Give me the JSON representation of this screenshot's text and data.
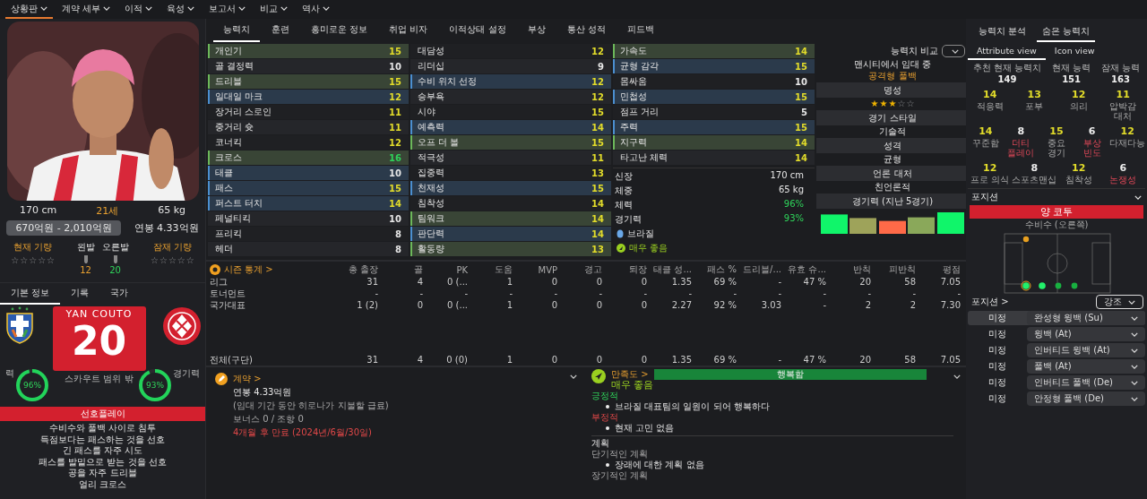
{
  "nav": [
    {
      "label": "상황판",
      "selected": true
    },
    {
      "label": "계약 세부",
      "selected": false
    },
    {
      "label": "이적",
      "selected": false
    },
    {
      "label": "육성",
      "selected": false
    },
    {
      "label": "보고서",
      "selected": false
    },
    {
      "label": "비교",
      "selected": false
    },
    {
      "label": "역사",
      "selected": false
    }
  ],
  "player": {
    "height": "170 cm",
    "age": "21세",
    "weight": "65 kg",
    "value_range": "670억원 - 2,010억원",
    "wage": "연봉 4.33억원",
    "current_ability": {
      "label": "현재 기량",
      "stars": 0
    },
    "potential_ability": {
      "label": "잠재 기량",
      "stars": 0
    },
    "feet": [
      {
        "label": "왼발",
        "value": "12",
        "color": "#e8a030"
      },
      {
        "label": "오른발",
        "value": "20",
        "color": "#2fd35a"
      }
    ]
  },
  "info_tabs": [
    {
      "label": "기본 정보",
      "selected": true
    },
    {
      "label": "기록",
      "selected": false
    },
    {
      "label": "국가",
      "selected": false
    }
  ],
  "shirt": {
    "name": "YAN COUTO",
    "number": "20",
    "note": "스카우트 범위 밖"
  },
  "rings": [
    {
      "label": "력",
      "value": "96%",
      "level": 0.96
    },
    {
      "label": "경기력",
      "value": "93%",
      "level": 0.93
    }
  ],
  "preferred_play": {
    "title": "선호플레이",
    "items": [
      "수비수와 풀백 사이로 침투",
      "득점보다는 패스하는 것을 선호",
      "긴 패스를 자주 시도",
      "패스를 발밑으로 받는 것을 선호",
      "공을 자주 드리블",
      "얼리 크로스"
    ]
  },
  "tabs": [
    {
      "label": "능력치",
      "selected": true
    },
    {
      "label": "훈련",
      "selected": false
    },
    {
      "label": "흥미로운 정보",
      "selected": false
    },
    {
      "label": "취업 비자",
      "selected": false
    },
    {
      "label": "이적상태 설정",
      "selected": false
    },
    {
      "label": "부상",
      "selected": false
    },
    {
      "label": "통산 성적",
      "selected": false
    },
    {
      "label": "피드백",
      "selected": false
    }
  ],
  "attributes": [
    [
      {
        "label": "개인기",
        "value": "15",
        "kind": "strong",
        "color": "#e2dc2a"
      },
      {
        "label": "골 결정력",
        "value": "10",
        "kind": "plain",
        "color": "#e6e6e6"
      },
      {
        "label": "드리블",
        "value": "15",
        "kind": "strong",
        "color": "#e2dc2a"
      },
      {
        "label": "일대일 마크",
        "value": "12",
        "kind": "key",
        "color": "#e2dc2a"
      },
      {
        "label": "장거리 스로인",
        "value": "11",
        "kind": "plain",
        "color": "#e2dc2a"
      },
      {
        "label": "중거리 슛",
        "value": "11",
        "kind": "plain",
        "color": "#e2dc2a"
      },
      {
        "label": "코너킥",
        "value": "12",
        "kind": "plain",
        "color": "#e2dc2a"
      },
      {
        "label": "크로스",
        "value": "16",
        "kind": "strong",
        "color": "#2fd35a"
      },
      {
        "label": "태클",
        "value": "10",
        "kind": "key",
        "color": "#e6e6e6"
      },
      {
        "label": "패스",
        "value": "15",
        "kind": "key",
        "color": "#e2dc2a"
      },
      {
        "label": "퍼스트 터치",
        "value": "14",
        "kind": "key",
        "color": "#e2dc2a"
      },
      {
        "label": "페널티킥",
        "value": "10",
        "kind": "plain",
        "color": "#e6e6e6"
      },
      {
        "label": "프리킥",
        "value": "8",
        "kind": "plain",
        "color": "#e6e6e6"
      },
      {
        "label": "헤더",
        "value": "8",
        "kind": "plain",
        "color": "#e6e6e6"
      }
    ],
    [
      {
        "label": "대담성",
        "value": "12",
        "kind": "plain",
        "color": "#e2dc2a"
      },
      {
        "label": "리더십",
        "value": "9",
        "kind": "plain",
        "color": "#e6e6e6"
      },
      {
        "label": "수비 위치 선정",
        "value": "12",
        "kind": "key",
        "color": "#e2dc2a"
      },
      {
        "label": "승부욕",
        "value": "12",
        "kind": "plain",
        "color": "#e2dc2a"
      },
      {
        "label": "시야",
        "value": "15",
        "kind": "plain",
        "color": "#e2dc2a"
      },
      {
        "label": "예측력",
        "value": "14",
        "kind": "key",
        "color": "#e2dc2a"
      },
      {
        "label": "오프 더 볼",
        "value": "15",
        "kind": "strong",
        "color": "#e2dc2a"
      },
      {
        "label": "적극성",
        "value": "11",
        "kind": "plain",
        "color": "#e2dc2a"
      },
      {
        "label": "집중력",
        "value": "13",
        "kind": "plain",
        "color": "#e2dc2a"
      },
      {
        "label": "천재성",
        "value": "15",
        "kind": "key",
        "color": "#e2dc2a"
      },
      {
        "label": "침착성",
        "value": "14",
        "kind": "plain",
        "color": "#e2dc2a"
      },
      {
        "label": "팀워크",
        "value": "14",
        "kind": "strong",
        "color": "#e2dc2a"
      },
      {
        "label": "판단력",
        "value": "14",
        "kind": "key",
        "color": "#e2dc2a"
      },
      {
        "label": "활동량",
        "value": "13",
        "kind": "strong",
        "color": "#e2dc2a"
      }
    ],
    [
      {
        "label": "가속도",
        "value": "14",
        "kind": "strong",
        "color": "#e2dc2a"
      },
      {
        "label": "균형 감각",
        "value": "15",
        "kind": "key",
        "color": "#e2dc2a"
      },
      {
        "label": "몸싸움",
        "value": "10",
        "kind": "plain",
        "color": "#e6e6e6"
      },
      {
        "label": "민첩성",
        "value": "15",
        "kind": "key",
        "color": "#e2dc2a"
      },
      {
        "label": "점프 거리",
        "value": "5",
        "kind": "plain",
        "color": "#e6e6e6"
      },
      {
        "label": "주력",
        "value": "15",
        "kind": "key",
        "color": "#e2dc2a"
      },
      {
        "label": "지구력",
        "value": "14",
        "kind": "strong",
        "color": "#e2dc2a"
      },
      {
        "label": "타고난 체력",
        "value": "14",
        "kind": "plain",
        "color": "#e2dc2a"
      }
    ]
  ],
  "physical": [
    {
      "label": "신장",
      "value": "170 cm",
      "color": "#e6e6e6"
    },
    {
      "label": "체중",
      "value": "65 kg",
      "color": "#e6e6e6"
    },
    {
      "label": "체력",
      "value": "96%",
      "color": "#2fd35a"
    },
    {
      "label": "경기력",
      "value": "93%",
      "color": "#2fd35a"
    }
  ],
  "nationality": "브라질",
  "condition": "매우 좋음",
  "profile": {
    "compare_label": "능력치 비교",
    "status": "맨시티에서 임대 중",
    "role": "공격형 풀백",
    "sections": [
      {
        "title": "명성",
        "kind": "stars",
        "stars": 3
      },
      {
        "title": "경기 스타일",
        "kind": "text",
        "value": "기술적"
      },
      {
        "title": "성격",
        "kind": "text",
        "value": "균형"
      },
      {
        "title": "언론 대처",
        "kind": "text",
        "value": "친언론적"
      },
      {
        "title": "경기력 (지난 5경기)",
        "kind": "form"
      }
    ]
  },
  "season_stats": {
    "title": "시즌 통계 >",
    "columns": [
      "총 출장",
      "골",
      "PK",
      "도움",
      "MVP",
      "경고",
      "퇴장",
      "태클 성...",
      "패스 %",
      "드리블/...",
      "유효 슈...",
      "반칙",
      "피반칙",
      "평점"
    ],
    "rows": [
      {
        "label": "리그",
        "cells": [
          "31",
          "4",
          "0 (...",
          "1",
          "0",
          "0",
          "0",
          "1.35",
          "69 %",
          "-",
          "47 %",
          "20",
          "58",
          "7.05"
        ]
      },
      {
        "label": "토너먼트",
        "cells": [
          "-",
          "-",
          "-",
          "-",
          "-",
          "-",
          "-",
          "-",
          "-",
          "-",
          "-",
          "-",
          "-",
          "-"
        ]
      },
      {
        "label": "국가대표",
        "cells": [
          "1 (2)",
          "0",
          "0 (...",
          "1",
          "0",
          "0",
          "0",
          "2.27",
          "92 %",
          "3.03",
          "-",
          "2",
          "2",
          "7.30"
        ]
      }
    ],
    "total": {
      "label": "전체(구단)",
      "cells": [
        "31",
        "4",
        "0 (0)",
        "1",
        "0",
        "0",
        "0",
        "1.35",
        "69 %",
        "-",
        "47 %",
        "20",
        "58",
        "7.05"
      ]
    }
  },
  "contract": {
    "title": "계약 >",
    "wage": "연봉 4.33억원",
    "note": "(임대 기간 동안 히로나가 지불할 급료)",
    "bonus": "보너스 0 / 조항 0",
    "expiry": "4개월 후 만료 (2024년/6월/30일)"
  },
  "morale": {
    "title": "만족도 >",
    "bar": {
      "label": "행복함",
      "level": 1
    },
    "status": "매우 좋음",
    "positive": {
      "title": "긍정적",
      "items": [
        "브라질 대표팀의 일원이 되어 행복하다"
      ]
    },
    "negative": {
      "title": "부정적",
      "items": [
        "현재 고민 없음"
      ]
    },
    "plans": {
      "title": "계획",
      "short_title": "단기적인 계획",
      "short_items": [
        "장래에 대한 계획 없음"
      ],
      "long_title": "장기적인 계획"
    }
  },
  "right": {
    "tabs": [
      {
        "label": "능력치 분석",
        "selected": false
      },
      {
        "label": "숨은 능력치",
        "selected": true
      }
    ],
    "views": [
      {
        "label": "Attribute view",
        "selected": true
      },
      {
        "label": "Icon view",
        "selected": false
      }
    ],
    "abilities": [
      {
        "label": "추천 현재 능력치",
        "value": "149"
      },
      {
        "label": "현재 능력",
        "value": "151"
      },
      {
        "label": "잠재 능력",
        "value": "163"
      }
    ],
    "hidden": [
      [
        {
          "value": "14",
          "label": "적응력",
          "good": true,
          "negative": false
        },
        {
          "value": "13",
          "label": "포부",
          "good": true,
          "negative": false
        },
        {
          "value": "12",
          "label": "의리",
          "good": true,
          "negative": false
        },
        {
          "value": "11",
          "label": "압박감 대처",
          "good": true,
          "negative": false
        }
      ],
      [
        {
          "value": "14",
          "label": "꾸준함",
          "good": true,
          "negative": false
        },
        {
          "value": "8",
          "label": "더티 플레이",
          "good": false,
          "negative": true
        },
        {
          "value": "15",
          "label": "중요 경기",
          "good": true,
          "negative": false
        },
        {
          "value": "6",
          "label": "부상 빈도",
          "good": false,
          "negative": true
        },
        {
          "value": "12",
          "label": "다재다능",
          "good": true,
          "negative": false
        }
      ],
      [
        {
          "value": "12",
          "label": "프로 의식",
          "good": true,
          "negative": false
        },
        {
          "value": "8",
          "label": "스포츠맨십",
          "good": false,
          "negative": false
        },
        {
          "value": "12",
          "label": "침착성",
          "good": true,
          "negative": false
        },
        {
          "value": "6",
          "label": "논쟁성",
          "good": false,
          "negative": true
        }
      ]
    ],
    "position": {
      "title": "포지션",
      "player": "양 코투",
      "role": "수비수 (오른쪽)"
    },
    "roles": {
      "title": "포지션 >",
      "filter": "강조",
      "items": [
        {
          "duty": "미정",
          "role": "완성형 윙백 (Su)",
          "selected": true
        },
        {
          "duty": "미정",
          "role": "윙백 (At)",
          "selected": false
        },
        {
          "duty": "미정",
          "role": "인버티드 윙백 (At)",
          "selected": false
        },
        {
          "duty": "미정",
          "role": "풀백 (At)",
          "selected": false
        },
        {
          "duty": "미정",
          "role": "인버티드 풀백 (De)",
          "selected": false
        },
        {
          "duty": "미정",
          "role": "안정형 풀백 (De)",
          "selected": false
        }
      ]
    }
  }
}
